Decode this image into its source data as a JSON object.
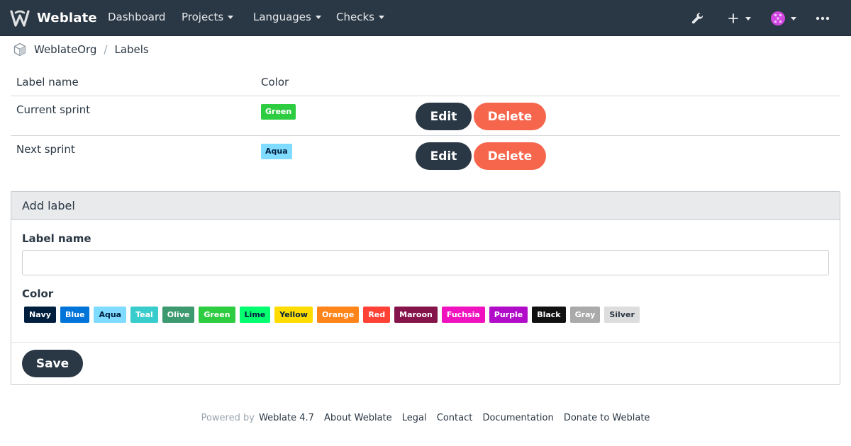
{
  "navbar": {
    "brand": "Weblate",
    "items": [
      {
        "label": "Dashboard"
      },
      {
        "label": "Projects"
      },
      {
        "label": "Languages"
      },
      {
        "label": "Checks"
      }
    ],
    "icons": [
      "wrench-icon",
      "plus-icon",
      "avatar-icon",
      "more-icon"
    ]
  },
  "breadcrumb": {
    "org": "WeblateOrg",
    "separator": "/",
    "page": "Labels"
  },
  "table": {
    "headers": {
      "name": "Label name",
      "color": "Color"
    },
    "rows": [
      {
        "name": "Current sprint",
        "color_label": "Green",
        "color_hex": "#2ecc40",
        "edit": "Edit",
        "delete": "Delete"
      },
      {
        "name": "Next sprint",
        "color_label": "Aqua",
        "color_hex": "#7fdbff",
        "edit": "Edit",
        "delete": "Delete"
      }
    ]
  },
  "add_label": {
    "heading": "Add label",
    "name_label": "Label name",
    "name_value": "",
    "color_label": "Color",
    "colors": [
      {
        "label": "Navy",
        "hex": "#001f3f"
      },
      {
        "label": "Blue",
        "hex": "#0074d9"
      },
      {
        "label": "Aqua",
        "hex": "#7fdbff"
      },
      {
        "label": "Teal",
        "hex": "#39cccc"
      },
      {
        "label": "Olive",
        "hex": "#3d9970"
      },
      {
        "label": "Green",
        "hex": "#2ecc40"
      },
      {
        "label": "Lime",
        "hex": "#01ff70"
      },
      {
        "label": "Yellow",
        "hex": "#ffdc00"
      },
      {
        "label": "Orange",
        "hex": "#ff851b"
      },
      {
        "label": "Red",
        "hex": "#ff4136"
      },
      {
        "label": "Maroon",
        "hex": "#85144b"
      },
      {
        "label": "Fuchsia",
        "hex": "#f012be"
      },
      {
        "label": "Purple",
        "hex": "#b10dc9"
      },
      {
        "label": "Black",
        "hex": "#111111"
      },
      {
        "label": "Gray",
        "hex": "#aaaaaa"
      },
      {
        "label": "Silver",
        "hex": "#dddddd"
      }
    ],
    "save": "Save"
  },
  "footer": {
    "powered_by": "Powered by",
    "version": "Weblate 4.7",
    "links": [
      "About Weblate",
      "Legal",
      "Contact",
      "Documentation",
      "Donate to Weblate"
    ]
  },
  "theme": {
    "navbar_bg": "#2a3744",
    "primary": "#2a3744",
    "danger": "#f6664c"
  }
}
